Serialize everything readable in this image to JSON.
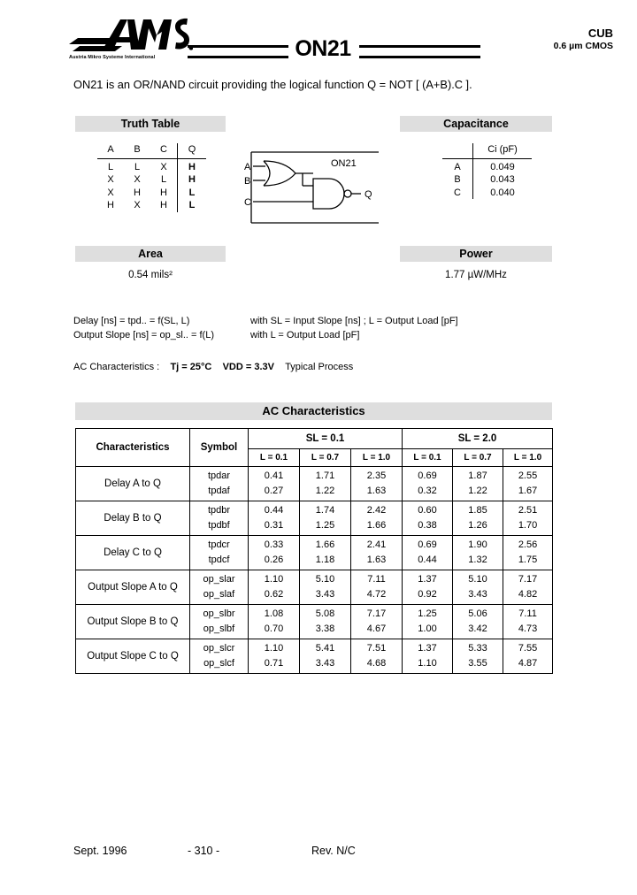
{
  "header": {
    "logo_text": "AMS",
    "logo_tagline": "Austria Mikro Systeme International",
    "part_number": "ON21",
    "family": "CUB",
    "process": "0.6 µm CMOS"
  },
  "intro": "ON21 is an OR/NAND circuit providing the logical function Q = NOT [ (A+B).C ].",
  "sections": {
    "truth_table_title": "Truth Table",
    "capacitance_title": "Capacitance",
    "area_title": "Area",
    "power_title": "Power",
    "ac_title": "AC Characteristics"
  },
  "truth_table": {
    "headers": [
      "A",
      "B",
      "C",
      "Q"
    ],
    "rows": [
      [
        "L",
        "L",
        "X",
        "H"
      ],
      [
        "X",
        "X",
        "L",
        "H"
      ],
      [
        "X",
        "H",
        "H",
        "L"
      ],
      [
        "H",
        "X",
        "H",
        "L"
      ]
    ]
  },
  "capacitance": {
    "value_header": "Ci (pF)",
    "rows": [
      {
        "pin": "A",
        "ci": "0.049"
      },
      {
        "pin": "B",
        "ci": "0.043"
      },
      {
        "pin": "C",
        "ci": "0.040"
      }
    ]
  },
  "schematic": {
    "label": "ON21",
    "input_a": "A",
    "input_b": "B",
    "input_c": "C",
    "output_q": "Q"
  },
  "area": {
    "value": "0.54  mils²"
  },
  "power": {
    "value": "1.77 µW/MHz"
  },
  "notes": {
    "line1_left": "Delay [ns]  =  tpd..  =  f(SL, L)",
    "line1_right": "with  SL = Input Slope [ns] ;  L = Output Load [pF]",
    "line2_left": "Output Slope [ns]  =  op_sl..  =  f(L)",
    "line2_right": "with  L = Output Load [pF]",
    "ac_conditions_label": "AC Characteristics :",
    "ac_tj": "Tj = 25°C",
    "ac_vdd": "VDD = 3.3V",
    "ac_process": "Typical Process"
  },
  "ac_table": {
    "col_characteristics": "Characteristics",
    "col_symbol": "Symbol",
    "group1": "SL = 0.1",
    "group2": "SL = 2.0",
    "load_headers": [
      "L = 0.1",
      "L = 0.7",
      "L = 1.0"
    ],
    "rows": [
      {
        "name": "Delay A to Q",
        "symbol_rise": "tpdar",
        "symbol_fall": "tpdaf",
        "sl01": {
          "rise": [
            "0.41",
            "1.71",
            "2.35"
          ],
          "fall": [
            "0.27",
            "1.22",
            "1.63"
          ]
        },
        "sl20": {
          "rise": [
            "0.69",
            "1.87",
            "2.55"
          ],
          "fall": [
            "0.32",
            "1.22",
            "1.67"
          ]
        }
      },
      {
        "name": "Delay B to Q",
        "symbol_rise": "tpdbr",
        "symbol_fall": "tpdbf",
        "sl01": {
          "rise": [
            "0.44",
            "1.74",
            "2.42"
          ],
          "fall": [
            "0.31",
            "1.25",
            "1.66"
          ]
        },
        "sl20": {
          "rise": [
            "0.60",
            "1.85",
            "2.51"
          ],
          "fall": [
            "0.38",
            "1.26",
            "1.70"
          ]
        }
      },
      {
        "name": "Delay C to Q",
        "symbol_rise": "tpdcr",
        "symbol_fall": "tpdcf",
        "sl01": {
          "rise": [
            "0.33",
            "1.66",
            "2.41"
          ],
          "fall": [
            "0.26",
            "1.18",
            "1.63"
          ]
        },
        "sl20": {
          "rise": [
            "0.69",
            "1.90",
            "2.56"
          ],
          "fall": [
            "0.44",
            "1.32",
            "1.75"
          ]
        }
      },
      {
        "name": "Output Slope A to Q",
        "symbol_rise": "op_slar",
        "symbol_fall": "op_slaf",
        "sl01": {
          "rise": [
            "1.10",
            "5.10",
            "7.11"
          ],
          "fall": [
            "0.62",
            "3.43",
            "4.72"
          ]
        },
        "sl20": {
          "rise": [
            "1.37",
            "5.10",
            "7.17"
          ],
          "fall": [
            "0.92",
            "3.43",
            "4.82"
          ]
        }
      },
      {
        "name": "Output Slope B to Q",
        "symbol_rise": "op_slbr",
        "symbol_fall": "op_slbf",
        "sl01": {
          "rise": [
            "1.08",
            "5.08",
            "7.17"
          ],
          "fall": [
            "0.70",
            "3.38",
            "4.67"
          ]
        },
        "sl20": {
          "rise": [
            "1.25",
            "5.06",
            "7.11"
          ],
          "fall": [
            "1.00",
            "3.42",
            "4.73"
          ]
        }
      },
      {
        "name": "Output Slope C to Q",
        "symbol_rise": "op_slcr",
        "symbol_fall": "op_slcf",
        "sl01": {
          "rise": [
            "1.10",
            "5.41",
            "7.51"
          ],
          "fall": [
            "0.71",
            "3.43",
            "4.68"
          ]
        },
        "sl20": {
          "rise": [
            "1.37",
            "5.33",
            "7.55"
          ],
          "fall": [
            "1.10",
            "3.55",
            "4.87"
          ]
        }
      }
    ]
  },
  "footer": {
    "date": "Sept. 1996",
    "page": "- 310 -",
    "revision": "Rev. N/C"
  }
}
